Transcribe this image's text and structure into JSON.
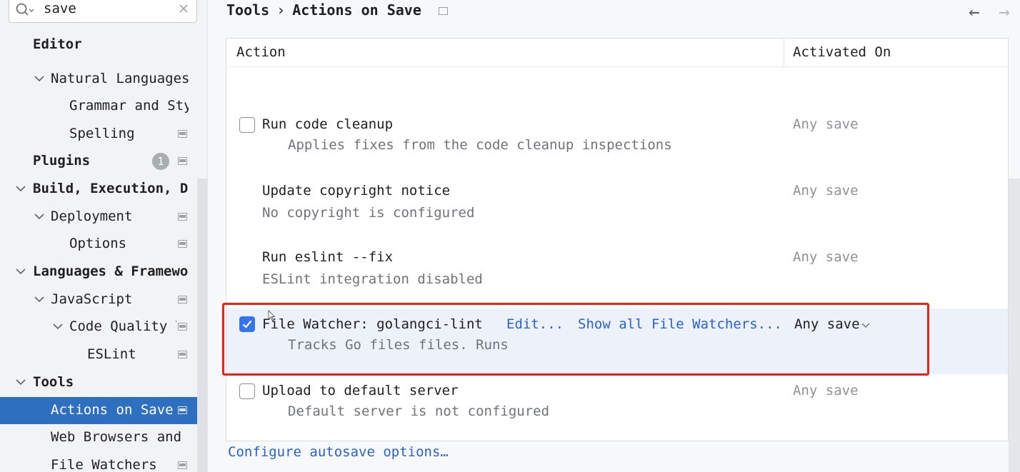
{
  "search": {
    "value": "save"
  },
  "sidebar": {
    "items": [
      {
        "label": "Editor"
      },
      {
        "label": "Natural Languages"
      },
      {
        "label": "Grammar and Sty"
      },
      {
        "label": "Spelling"
      },
      {
        "label": "Plugins",
        "badge": "1"
      },
      {
        "label": "Build, Execution, D"
      },
      {
        "label": "Deployment"
      },
      {
        "label": "Options"
      },
      {
        "label": "Languages & Framewo"
      },
      {
        "label": "JavaScript"
      },
      {
        "label": "Code Quality T"
      },
      {
        "label": "ESLint"
      },
      {
        "label": "Tools"
      },
      {
        "label": "Actions on Save"
      },
      {
        "label": "Web Browsers and P"
      },
      {
        "label": "File Watchers"
      }
    ]
  },
  "header": {
    "breadcrumb_parent": "Tools",
    "breadcrumb_separator": "›",
    "breadcrumb_current": "Actions on Save",
    "back_icon": "arrow-left-icon",
    "forward_icon": "arrow-right-icon"
  },
  "table": {
    "columns": [
      "Action",
      "Activated On"
    ],
    "rows": [
      {
        "title": "Run code cleanup",
        "description": "Applies fixes from the code cleanup inspections",
        "activated_on": "Any save",
        "checked": false
      },
      {
        "title": "Update copyright notice",
        "description": "No copyright is configured",
        "activated_on": "Any save"
      },
      {
        "title": "Run eslint --fix",
        "description": "ESLint integration disabled",
        "activated_on": "Any save"
      },
      {
        "title": "File Watcher: golangci-lint",
        "description": "Tracks Go files files. Runs",
        "activated_on": "Any save",
        "checked": true,
        "links": [
          "Edit...",
          "Show all File Watchers..."
        ]
      },
      {
        "title": "Upload to default server",
        "description": "Default server is not configured",
        "activated_on": "Any save",
        "checked": false
      }
    ]
  },
  "footer": {
    "configure_link": "Configure autosave options…"
  },
  "colors": {
    "selection": "#2f6fbf",
    "link": "#2a62c9",
    "highlight_box": "#e8231a",
    "checkbox_checked": "#3574f0"
  }
}
